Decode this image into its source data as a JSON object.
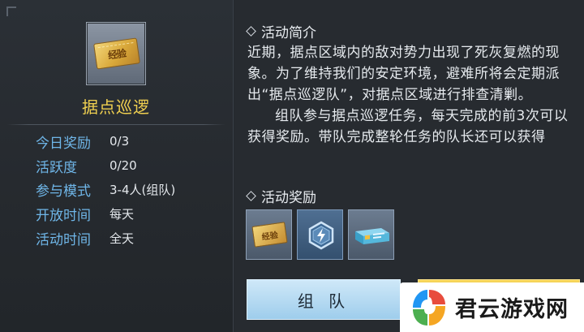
{
  "item": {
    "name": "据点巡逻",
    "icon": "exp-ticket-icon",
    "icon_text": "经验"
  },
  "info": [
    {
      "key": "今日奖励",
      "value": "0/3"
    },
    {
      "key": "活跃度",
      "value": "0/20"
    },
    {
      "key": "参与模式",
      "value": "3-4人(组队)"
    },
    {
      "key": "开放时间",
      "value": "每天"
    },
    {
      "key": "活动时间",
      "value": "全天"
    }
  ],
  "intro": {
    "title": "活动简介",
    "paragraph1": "近期，据点区域内的敌对势力出现了死灰复燃的现象。为了维持我们的安定环境，避难所将会定期派出“据点巡逻队”，对据点区域进行排查清剿。",
    "paragraph2": "组队参与据点巡逻任务，每天完成的前3次可以获得奖励。带队完成整轮任务的队长还可以获得"
  },
  "rewards": {
    "title": "活动奖励",
    "items": [
      {
        "icon": "exp-ticket-icon",
        "text": "经验"
      },
      {
        "icon": "lightning-hexagon-icon"
      },
      {
        "icon": "supply-crate-icon"
      }
    ]
  },
  "buttons": {
    "team": "组 队"
  },
  "watermark": {
    "text": "君云游戏网",
    "colors": [
      "#e84c3d",
      "#f5a623",
      "#4caf50",
      "#2196f3"
    ]
  },
  "colors": {
    "accent_gold": "#f0d050",
    "label_blue": "#6fb6e8",
    "button_blue": "#9ecdec",
    "button_gold": "#e3b530"
  }
}
